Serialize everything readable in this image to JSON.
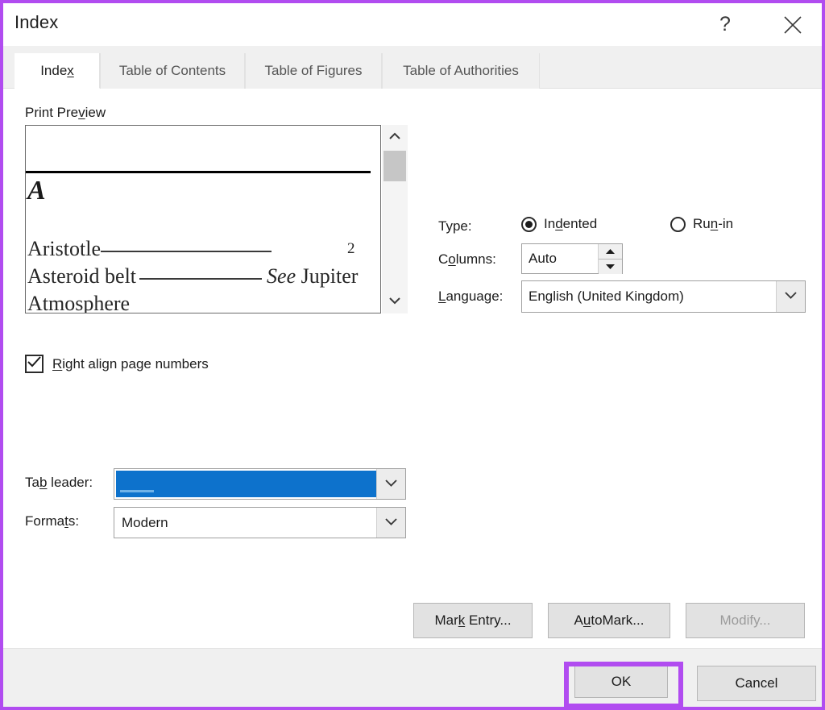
{
  "window": {
    "title": "Index",
    "help_icon": "question-mark-icon",
    "close_icon": "close-x-icon",
    "frame_highlight_color": "#b14cf0"
  },
  "tabs": [
    {
      "label": "Index",
      "accel": "x",
      "active": true
    },
    {
      "label": "Table of Contents",
      "active": false
    },
    {
      "label": "Table of Figures",
      "active": false
    },
    {
      "label": "Table of Authorities",
      "active": false
    }
  ],
  "preview": {
    "label_before": "Print Pre",
    "label_accel": "v",
    "label_after": "iew",
    "letter_heading": "A",
    "entries": [
      {
        "text": "Aristotle",
        "leader": true,
        "page": "2"
      },
      {
        "text": "Asteroid belt",
        "leader": true,
        "cross_ref_italic": "See",
        "cross_ref": "Jupiter"
      },
      {
        "text": "Atmosphere",
        "leader": false
      }
    ],
    "scrollbar": {
      "up_icon": "chevron-up-icon",
      "down_icon": "chevron-down-icon"
    }
  },
  "options": {
    "type_label": "Type:",
    "type_options": [
      {
        "label_before": "In",
        "accel": "d",
        "label_after": "ented",
        "selected": true
      },
      {
        "label_before": "Ru",
        "accel": "n",
        "label_after": "-in",
        "selected": false
      }
    ],
    "columns_label_before": "C",
    "columns_label_accel": "o",
    "columns_label_after": "lumns:",
    "columns_value": "Auto",
    "language_label_accel": "L",
    "language_label_after": "anguage:",
    "language_value": "English (United Kingdom)",
    "dropdown_icon": "chevron-down-icon",
    "spinner_up_icon": "triangle-up-icon",
    "spinner_down_icon": "triangle-down-icon"
  },
  "left_options": {
    "right_align_accel": "R",
    "right_align_after": "ight align page numbers",
    "right_align_checked": true,
    "checkbox_icon": "checkmark-icon",
    "tab_leader_before": "Ta",
    "tab_leader_accel": "b",
    "tab_leader_after": " leader:",
    "tab_leader_value": "",
    "tab_leader_selected_color": "#0d72cc",
    "formats_before": "Forma",
    "formats_accel": "t",
    "formats_after": "s:",
    "formats_value": "Modern"
  },
  "buttons": {
    "mark_entry_before": "Mar",
    "mark_entry_accel": "k",
    "mark_entry_after": " Entry...",
    "automark_before": "A",
    "automark_accel": "u",
    "automark_after": "toMark...",
    "modify_label": "Modify...",
    "modify_disabled": true,
    "ok_label": "OK",
    "cancel_label": "Cancel"
  }
}
